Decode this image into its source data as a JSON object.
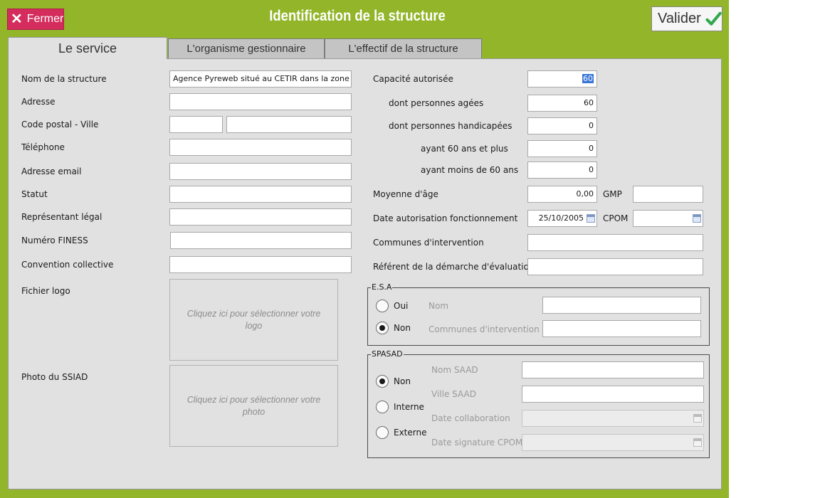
{
  "titlebar": {
    "title": "Identification de la structure",
    "close_label": "Fermer",
    "validate_label": "Valider"
  },
  "tabs": [
    {
      "label": "Le service",
      "active": true
    },
    {
      "label": "L'organisme gestionnaire",
      "active": false
    },
    {
      "label": "L'effectif de la structure",
      "active": false
    }
  ],
  "left": {
    "nom_structure": {
      "label": "Nom de la structure",
      "value": "Agence Pyreweb situé au CETIR dans la zone Pic Pyrénées"
    },
    "adresse": {
      "label": "Adresse",
      "value": ""
    },
    "cp_ville": {
      "label": "Code postal -  Ville",
      "cp": "",
      "ville": ""
    },
    "telephone": {
      "label": "Téléphone",
      "value": ""
    },
    "email": {
      "label": "Adresse email",
      "value": ""
    },
    "statut": {
      "label": "Statut",
      "value": ""
    },
    "representant": {
      "label": "Représentant légal",
      "value": ""
    },
    "finess": {
      "label": "Numéro FINESS",
      "value": ""
    },
    "convention": {
      "label": "Convention collective",
      "value": ""
    },
    "logo": {
      "label": "Fichier logo",
      "placeholder": "Cliquez ici pour sélectionner votre logo"
    },
    "photo": {
      "label": "Photo du SSIAD",
      "placeholder": "Cliquez ici pour sélectionner votre photo"
    }
  },
  "right": {
    "capacite": {
      "label": "Capacité autorisée",
      "value": "60"
    },
    "agees": {
      "label": "dont personnes agées",
      "value": "60"
    },
    "handicapees": {
      "label": "dont personnes handicapées",
      "value": "0"
    },
    "plus60": {
      "label": "ayant 60 ans et plus",
      "value": "0"
    },
    "moins60": {
      "label": "ayant moins de 60 ans",
      "value": "0"
    },
    "moyenne_age": {
      "label": "Moyenne d'âge",
      "value": "0,00"
    },
    "gmp": {
      "label": "GMP",
      "value": ""
    },
    "date_autorisation": {
      "label": "Date autorisation fonctionnement",
      "value": "25/10/2005"
    },
    "cpom": {
      "label": "CPOM",
      "value": ""
    },
    "communes": {
      "label": "Communes d'intervention",
      "value": ""
    },
    "referent": {
      "label": "Référent de la démarche d'évaluation",
      "value": ""
    }
  },
  "esa": {
    "title": "E.S.A",
    "options": [
      "Oui",
      "Non"
    ],
    "selected": "Non",
    "nom_label": "Nom",
    "communes_label": "Communes d'intervention"
  },
  "spasad": {
    "title": "SPASAD",
    "options": [
      "Non",
      "Interne",
      "Externe"
    ],
    "selected": "Non",
    "nom_saad_label": "Nom SAAD",
    "ville_saad_label": "Ville SAAD",
    "date_collab_label": "Date collaboration",
    "date_cpom_label": "Date signature CPOM"
  },
  "colors": {
    "frame": "#92b52a",
    "close": "#d42c5c",
    "check": "#2fa84f",
    "panel": "#e1e1e1"
  }
}
